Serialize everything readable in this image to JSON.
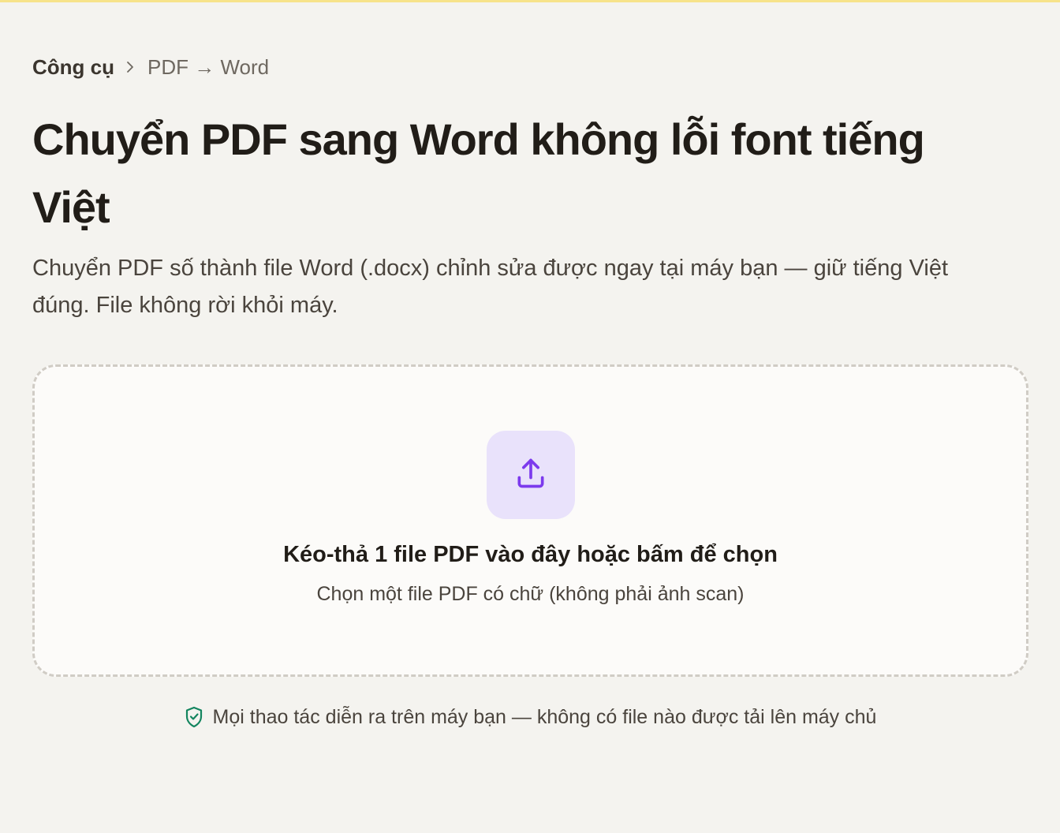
{
  "breadcrumb": {
    "root": "Công cụ",
    "current": "PDF → Word"
  },
  "page": {
    "title": "Chuyển PDF sang Word không lỗi font tiếng Việt",
    "description": "Chuyển PDF số thành file Word (.docx) chỉnh sửa được ngay tại máy bạn — giữ tiếng Việt đúng. File không rời khỏi máy."
  },
  "dropzone": {
    "icon": "upload-icon",
    "title": "Kéo-thả 1 file PDF vào đây hoặc bấm để chọn",
    "hint": "Chọn một file PDF có chữ (không phải ảnh scan)"
  },
  "privacy": {
    "icon": "shield-check-icon",
    "text": "Mọi thao tác diễn ra trên máy bạn — không có file nào được tải lên máy chủ"
  },
  "colors": {
    "background": "#f4f3ef",
    "top_accent": "#f7e38a",
    "upload_tile": "#e9e2fb",
    "upload_icon": "#7c3aed",
    "shield_icon": "#13855f"
  }
}
